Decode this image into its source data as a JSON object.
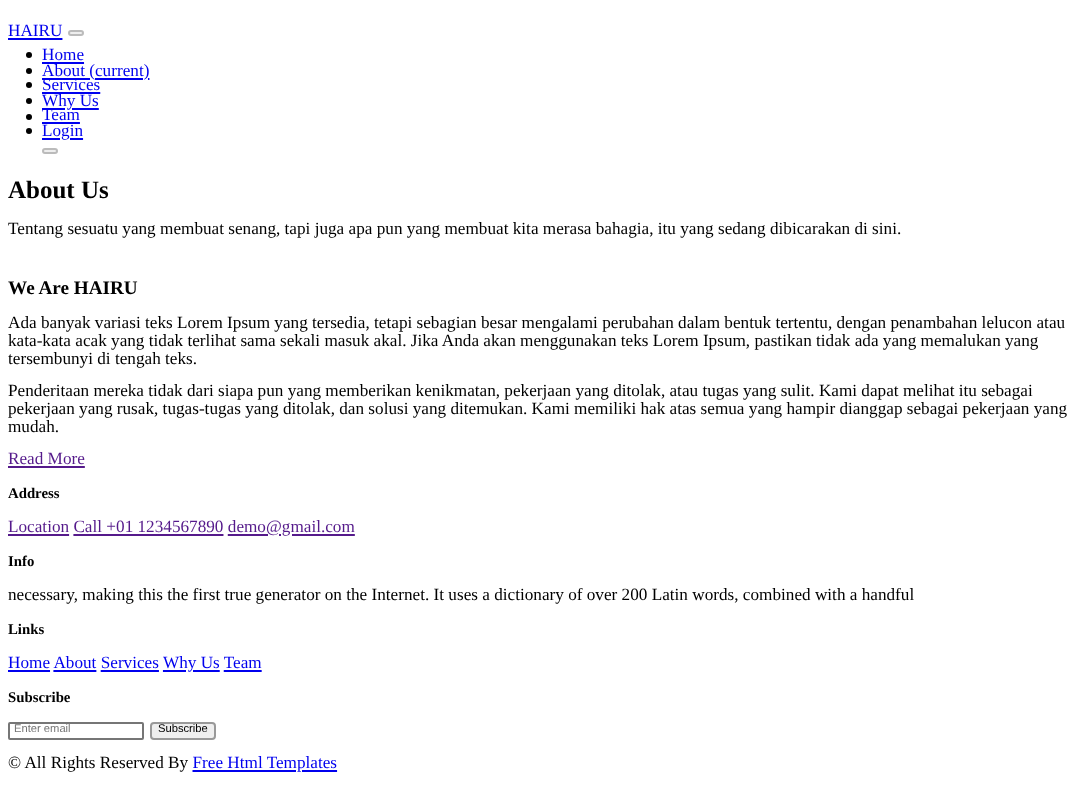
{
  "header": {
    "brand": "HAIRU",
    "nav": [
      {
        "label": "Home"
      },
      {
        "label": "About (current)"
      },
      {
        "label": "Services"
      },
      {
        "label": "Why Us"
      },
      {
        "label": "Team"
      },
      {
        "label": "Login"
      }
    ]
  },
  "about": {
    "title": "About Us",
    "intro": "Tentang sesuatu yang membuat senang, tapi juga apa pun yang membuat kita merasa bahagia, itu yang sedang dibicarakan di sini.",
    "subtitle": "We Are HAIRU",
    "paragraphs": [
      "Ada banyak variasi teks Lorem Ipsum yang tersedia, tetapi sebagian besar mengalami perubahan dalam bentuk tertentu, dengan penambahan lelucon atau kata-kata acak yang tidak terlihat sama sekali masuk akal. Jika Anda akan menggunakan teks Lorem Ipsum, pastikan tidak ada yang memalukan yang tersembunyi di tengah teks.",
      "Penderitaan mereka tidak dari siapa pun yang memberikan kenikmatan, pekerjaan yang ditolak, atau tugas yang sulit. Kami dapat melihat itu sebagai pekerjaan yang rusak, tugas-tugas yang ditolak, dan solusi yang ditemukan. Kami memiliki hak atas semua yang hampir dianggap sebagai pekerjaan yang mudah."
    ],
    "read_more": {
      "label": "Read More",
      "visited": true
    }
  },
  "address": {
    "title": "Address",
    "links": [
      {
        "label": "Location",
        "visited": true
      },
      {
        "label": "Call +01 1234567890",
        "visited": true
      },
      {
        "label": "demo@gmail.com",
        "visited": true
      }
    ]
  },
  "info": {
    "title": "Info",
    "text": "necessary, making this the first true generator on the Internet. It uses a dictionary of over 200 Latin words, combined with a handful"
  },
  "links": {
    "title": "Links",
    "items": [
      {
        "label": "Home",
        "visited": false
      },
      {
        "label": "About",
        "visited": false
      },
      {
        "label": "Services",
        "visited": false
      },
      {
        "label": "Why Us",
        "visited": false
      },
      {
        "label": "Team",
        "visited": false
      }
    ]
  },
  "subscribe": {
    "title": "Subscribe",
    "placeholder": "Enter email",
    "button": "Subscribe"
  },
  "footer": {
    "text": "© All Rights Reserved By",
    "link": {
      "label": "Free Html Templates",
      "visited": false
    }
  }
}
